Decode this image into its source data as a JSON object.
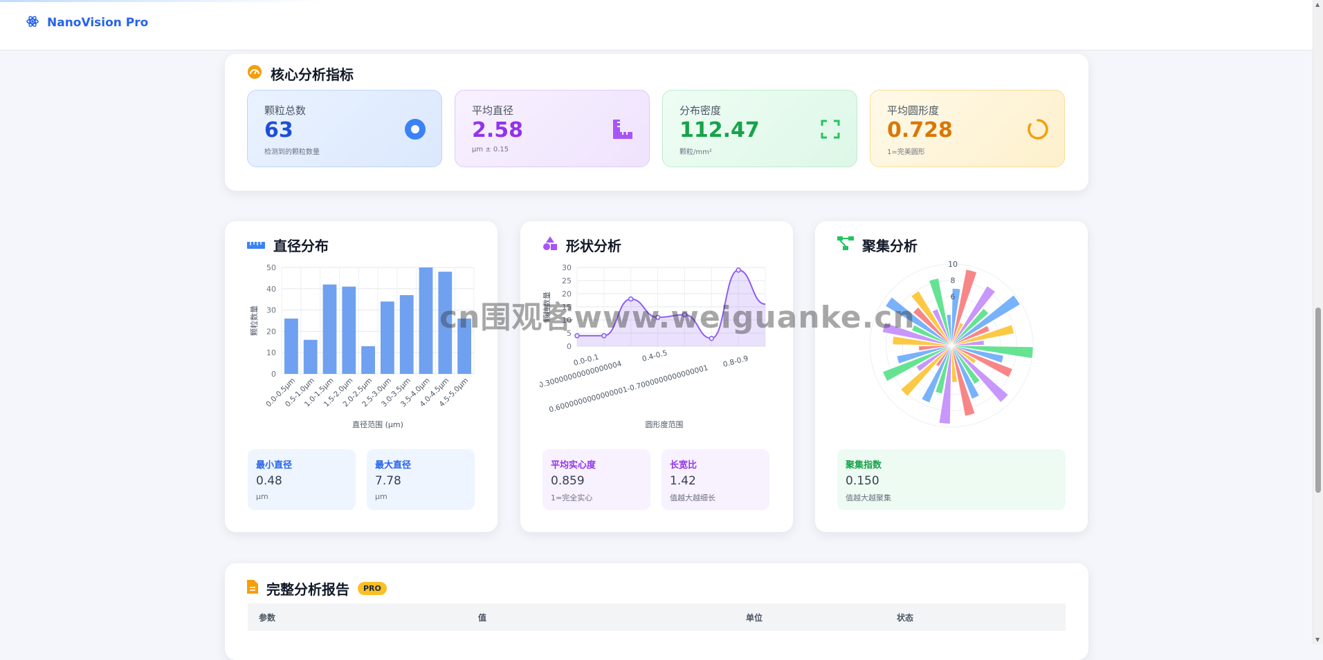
{
  "app": {
    "name": "NanoVision Pro"
  },
  "core": {
    "title": "核心分析指标",
    "metrics": [
      {
        "label": "颗粒总数",
        "value": "63",
        "sub": "检测到的颗粒数量",
        "icon": "target-icon",
        "color": "#2563eb"
      },
      {
        "label": "平均直径",
        "value": "2.58",
        "sub": "μm ± 0.15",
        "icon": "ruler-icon",
        "color": "#9333ea"
      },
      {
        "label": "分布密度",
        "value": "112.47",
        "sub": "颗粒/mm²",
        "icon": "expand-icon",
        "color": "#16a34a"
      },
      {
        "label": "平均圆形度",
        "value": "0.728",
        "sub": "1=完美圆形",
        "icon": "circle-notch-icon",
        "color": "#d97706"
      }
    ]
  },
  "diameter": {
    "title": "直径分布",
    "stats": [
      {
        "title": "最小直径",
        "value": "0.48",
        "unit": "μm"
      },
      {
        "title": "最大直径",
        "value": "7.78",
        "unit": "μm"
      }
    ]
  },
  "shape": {
    "title": "形状分析",
    "stats": [
      {
        "title": "平均实心度",
        "value": "0.859",
        "unit": "1=完全实心"
      },
      {
        "title": "长宽比",
        "value": "1.42",
        "unit": "值越大越细长"
      }
    ]
  },
  "cluster": {
    "title": "聚集分析",
    "stats": [
      {
        "title": "聚集指数",
        "value": "0.150",
        "unit": "值越大越聚集"
      }
    ]
  },
  "report": {
    "title": "完整分析报告",
    "badge": "PRO",
    "columns": [
      "参数",
      "值",
      "单位",
      "状态"
    ]
  },
  "watermark": "cn围观客www.weiguanke.cn",
  "chart_data": [
    {
      "type": "bar",
      "categories": [
        "0.0-0.5μm",
        "0.5-1.0μm",
        "1.0-1.5μm",
        "1.5-2.0μm",
        "2.0-2.5μm",
        "2.5-3.0μm",
        "3.0-3.5μm",
        "3.5-4.0μm",
        "4.0-4.5μm",
        "4.5-5.0μm"
      ],
      "values": [
        26,
        16,
        42,
        41,
        13,
        34,
        37,
        50,
        48,
        26
      ],
      "xlabel": "直径范围 (μm)",
      "ylabel": "颗粒数量",
      "ylim": [
        0,
        50
      ],
      "yticks": [
        0,
        10,
        20,
        30,
        40,
        50
      ],
      "grid": true,
      "color": "#6fa1f0"
    },
    {
      "type": "area",
      "x_labels": [
        "0.0-0.1",
        "0.30000000000000004",
        "0.4-0.5",
        "0.6000000000000001-0.7000000000000001",
        "0.8-0.9"
      ],
      "values": [
        4,
        4,
        18,
        11,
        12,
        3,
        29,
        16
      ],
      "xlabel": "圆形度范围",
      "ylabel": "颗粒数量",
      "ylim": [
        0,
        30
      ],
      "yticks": [
        0,
        5,
        10,
        15,
        20,
        25,
        30
      ],
      "grid": true,
      "color": "#8b5cf6"
    },
    {
      "type": "polar-bar",
      "rticks": [
        6,
        8,
        10
      ],
      "rmax": 10,
      "colors": [
        "#60a5fa",
        "#f87171",
        "#fbbf24",
        "#c084fc",
        "#4ade80"
      ],
      "values": [
        7,
        9.5,
        3,
        8.5,
        6,
        9.8,
        5,
        7.8,
        4,
        10,
        6.5,
        8,
        3.5,
        9.2,
        5.5,
        7,
        8.8,
        4.5,
        9.6,
        6,
        7.5,
        3,
        8.2,
        5,
        9,
        6.8,
        4,
        7.2,
        8.6,
        5.2,
        9.4,
        6.2,
        7.8,
        4.8,
        8.4,
        3.8
      ]
    }
  ]
}
